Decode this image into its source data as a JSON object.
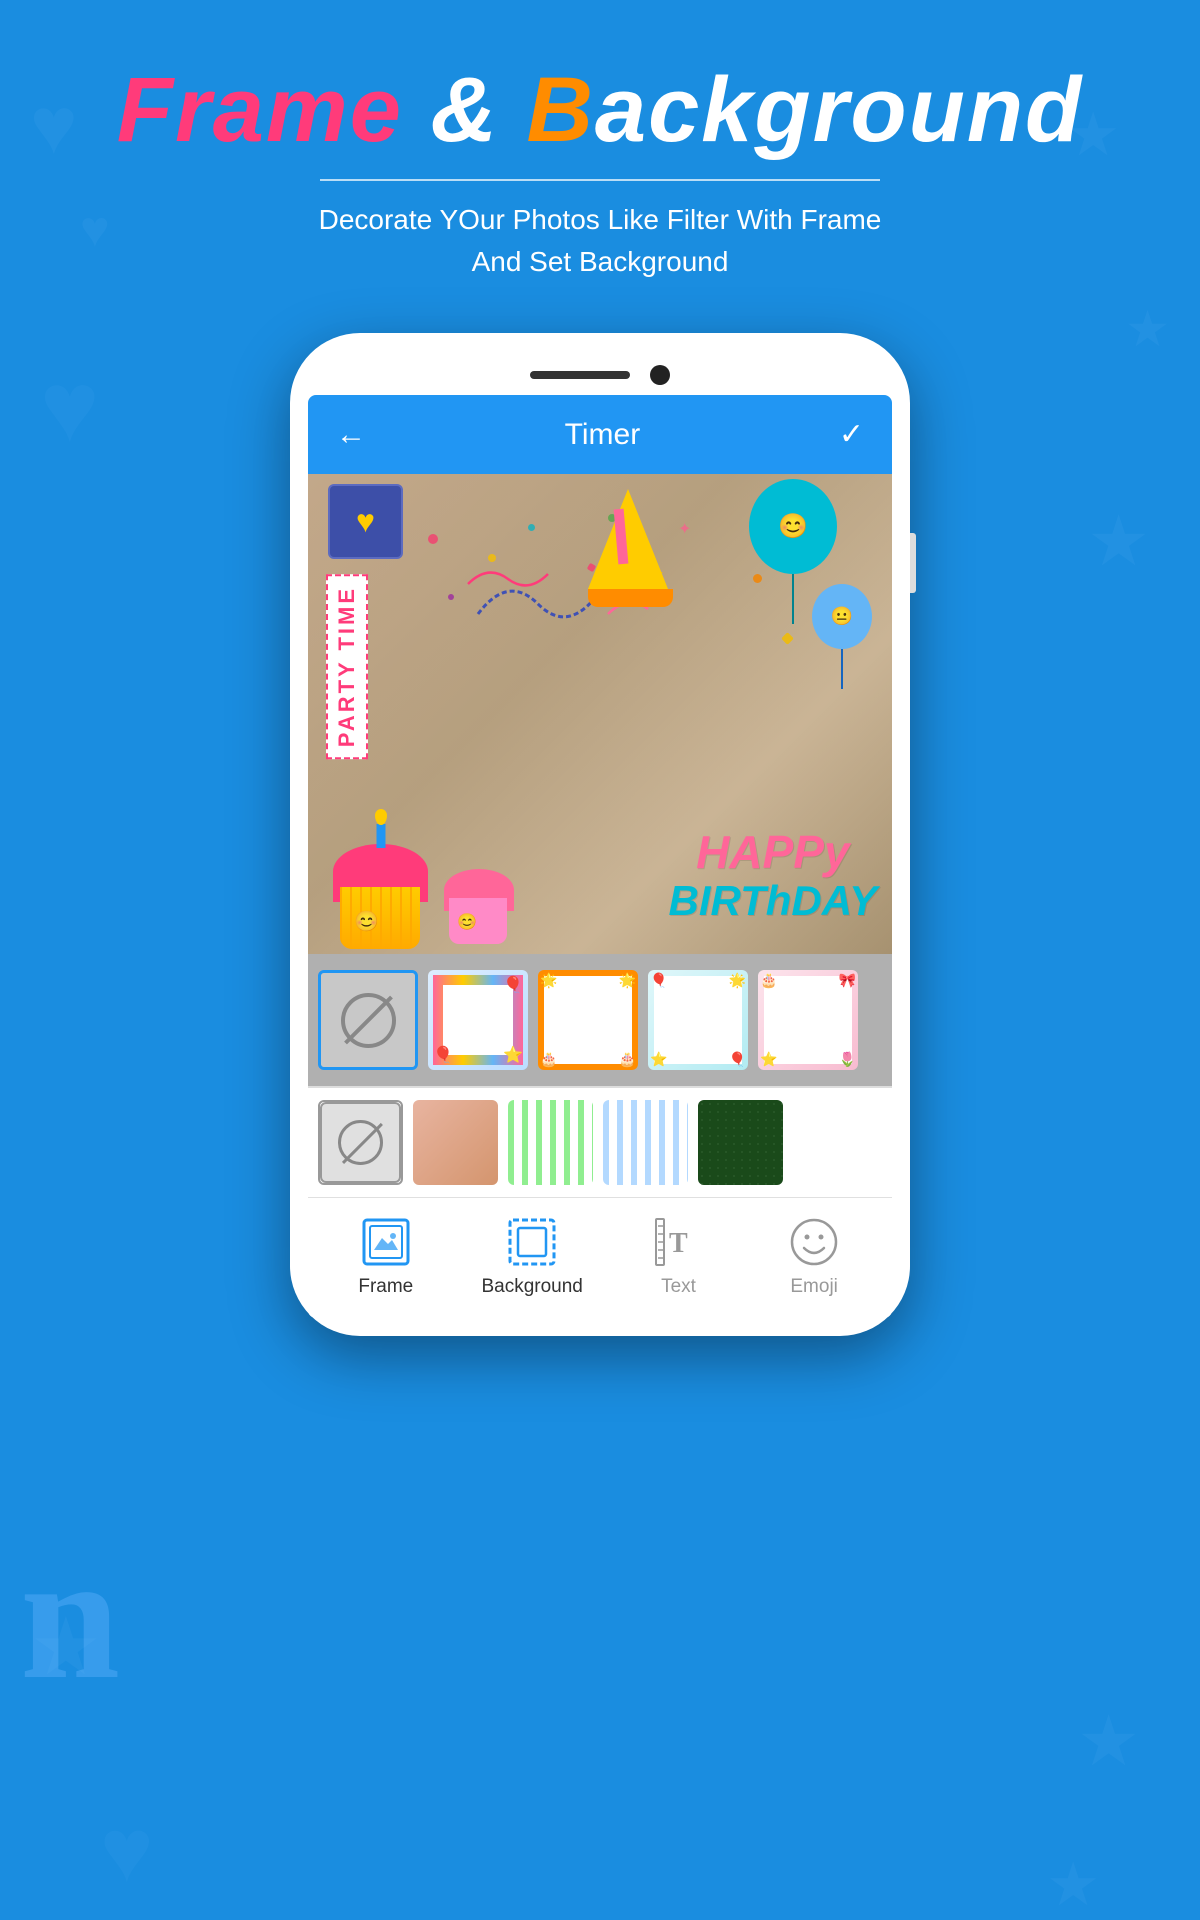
{
  "app": {
    "title_part1": "Frame",
    "title_and": " & ",
    "title_b": "B",
    "title_background": "ackground",
    "subtitle": "Decorate YOur Photos Like Filter With Frame\nAnd Set Background"
  },
  "phone": {
    "screen": {
      "app_bar": {
        "title": "Timer",
        "back_icon": "←",
        "check_icon": "✓"
      }
    }
  },
  "frame_selector": {
    "items": [
      {
        "id": "none",
        "label": "No Frame",
        "selected": true
      },
      {
        "id": "party-blue",
        "label": "Party Blue Frame"
      },
      {
        "id": "orange-festive",
        "label": "Orange Festive Frame"
      },
      {
        "id": "teal-balloon",
        "label": "Teal Balloon Frame"
      },
      {
        "id": "pink-party",
        "label": "Pink Party Frame"
      }
    ]
  },
  "bg_selector": {
    "items": [
      {
        "id": "none",
        "label": "No Background",
        "selected": true
      },
      {
        "id": "peach",
        "label": "Peach Background"
      },
      {
        "id": "green-stripes",
        "label": "Green Stripes Background"
      },
      {
        "id": "blue-stripes",
        "label": "Blue Stripes Background"
      },
      {
        "id": "dark-green",
        "label": "Dark Green Background"
      }
    ]
  },
  "toolbar": {
    "items": [
      {
        "id": "frame",
        "label": "Frame",
        "active": true
      },
      {
        "id": "background",
        "label": "Background",
        "active": true
      },
      {
        "id": "text",
        "label": "Text",
        "active": false
      },
      {
        "id": "emoji",
        "label": "Emoji",
        "active": false
      }
    ]
  },
  "photo": {
    "party_time_text": "PARTY TIME",
    "happy_text": "HAPPy",
    "birthday_text": "BIRThDAY"
  }
}
